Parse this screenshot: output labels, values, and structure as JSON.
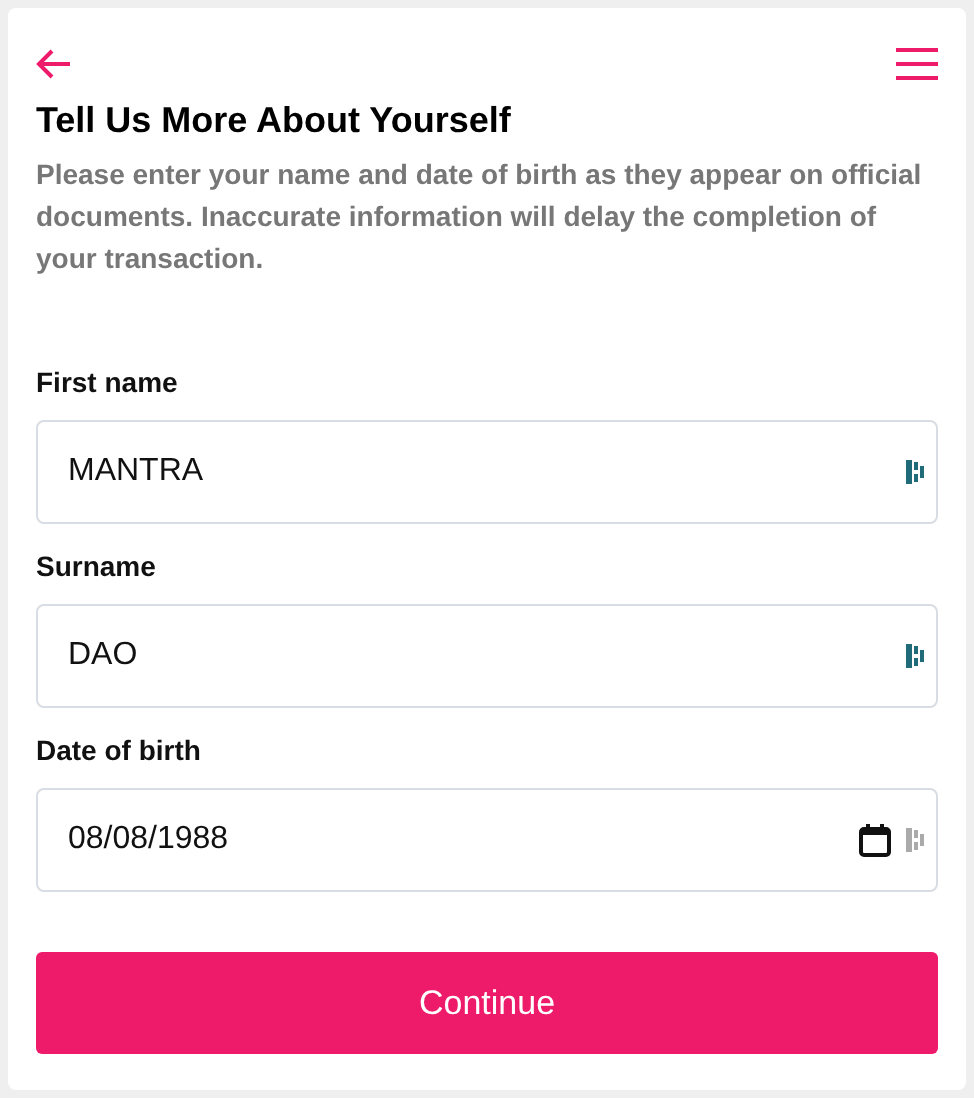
{
  "header": {
    "title": "Tell Us More About Yourself",
    "description": "Please enter your name and date of birth as they appear on official documents. Inaccurate information will delay the completion of your transaction."
  },
  "fields": [
    {
      "label": "First name",
      "value": "MANTRA",
      "kind": "text"
    },
    {
      "label": "Surname",
      "value": "DAO",
      "kind": "text"
    },
    {
      "label": "Date of birth",
      "value": "08/08/1988",
      "kind": "date"
    }
  ],
  "buttons": [
    "Continue"
  ]
}
